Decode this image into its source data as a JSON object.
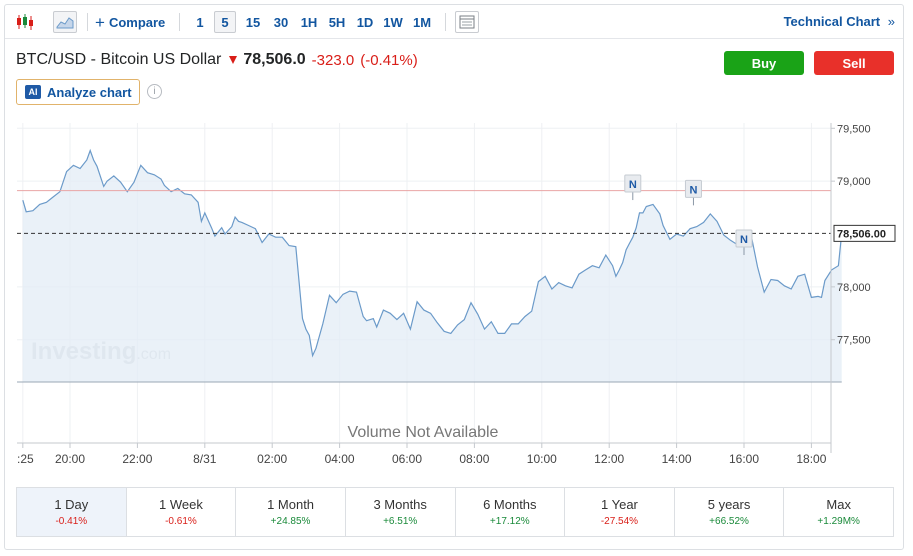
{
  "toolbar": {
    "compare_label": "Compare",
    "intervals": [
      "1",
      "5",
      "15",
      "30",
      "1H",
      "5H",
      "1D",
      "1W",
      "1M"
    ],
    "active_interval": "5",
    "technical_chart_label": "Technical Chart",
    "technical_chart_arrow": "»"
  },
  "instrument": {
    "name": "BTC/USD - Bitcoin US Dollar",
    "price": "78,506.0",
    "change": "-323.0",
    "change_pct": "(-0.41%)"
  },
  "actions": {
    "buy_label": "Buy",
    "sell_label": "Sell",
    "buy_color": "#1aa317",
    "sell_color": "#e8302a"
  },
  "analyze": {
    "ai_badge": "AI",
    "label": "Analyze chart",
    "info_glyph": "i"
  },
  "chart_data": {
    "type": "area",
    "watermark_main": "Investing",
    "watermark_suffix": ".com",
    "volume_text": "Volume Not Available",
    "y_ticks": [
      "79,500",
      "79,000",
      "78,000",
      "77,500"
    ],
    "y_tick_values": [
      79500,
      79000,
      78000,
      77500
    ],
    "ylim": [
      77100,
      79550
    ],
    "current_price_label": "78,506.00",
    "current_price": 78506,
    "prev_close_line": 78910,
    "x_ticks": [
      ":25",
      "20:00",
      "22:00",
      "8/31",
      "02:00",
      "04:00",
      "06:00",
      "08:00",
      "10:00",
      "12:00",
      "14:00",
      "16:00",
      "18:00"
    ],
    "x_tick_positions": [
      -0.4,
      1,
      3,
      5,
      7,
      9,
      11,
      13,
      15,
      17,
      19,
      21,
      23
    ],
    "news_markers": [
      {
        "label": "N",
        "x": 17.7,
        "y": 78840
      },
      {
        "label": "N",
        "x": 19.5,
        "y": 78790
      },
      {
        "label": "N",
        "x": 21,
        "y": 78320
      }
    ],
    "line_color": "#6b9ac9",
    "fill_color": "#e3ecf5",
    "series": [
      {
        "values": [
          [
            -0.4,
            78820
          ],
          [
            -0.3,
            78710
          ],
          [
            -0.1,
            78720
          ],
          [
            0.1,
            78780
          ],
          [
            0.3,
            78800
          ],
          [
            0.5,
            78850
          ],
          [
            0.7,
            78900
          ],
          [
            0.9,
            79090
          ],
          [
            1.1,
            79150
          ],
          [
            1.3,
            79120
          ],
          [
            1.5,
            79200
          ],
          [
            1.6,
            79290
          ],
          [
            1.7,
            79200
          ],
          [
            1.8,
            79140
          ],
          [
            2.0,
            78950
          ],
          [
            2.1,
            79000
          ],
          [
            2.3,
            79050
          ],
          [
            2.5,
            78990
          ],
          [
            2.7,
            78900
          ],
          [
            2.9,
            78990
          ],
          [
            3.0,
            79070
          ],
          [
            3.1,
            79150
          ],
          [
            3.3,
            79080
          ],
          [
            3.5,
            79060
          ],
          [
            3.7,
            79020
          ],
          [
            3.8,
            78960
          ],
          [
            4.0,
            78900
          ],
          [
            4.2,
            78930
          ],
          [
            4.4,
            78880
          ],
          [
            4.6,
            78870
          ],
          [
            4.8,
            78800
          ],
          [
            4.9,
            78620
          ],
          [
            5.0,
            78700
          ],
          [
            5.2,
            78560
          ],
          [
            5.3,
            78480
          ],
          [
            5.5,
            78560
          ],
          [
            5.6,
            78500
          ],
          [
            5.8,
            78570
          ],
          [
            5.9,
            78660
          ],
          [
            6.0,
            78620
          ],
          [
            6.1,
            78610
          ],
          [
            6.3,
            78580
          ],
          [
            6.5,
            78550
          ],
          [
            6.7,
            78420
          ],
          [
            6.9,
            78500
          ],
          [
            7.1,
            78470
          ],
          [
            7.3,
            78470
          ],
          [
            7.5,
            78390
          ],
          [
            7.7,
            78380
          ],
          [
            7.9,
            77700
          ],
          [
            8.0,
            77600
          ],
          [
            8.1,
            77540
          ],
          [
            8.2,
            77350
          ],
          [
            8.3,
            77420
          ],
          [
            8.5,
            77650
          ],
          [
            8.7,
            77920
          ],
          [
            8.9,
            77850
          ],
          [
            9.1,
            77930
          ],
          [
            9.3,
            77960
          ],
          [
            9.5,
            77950
          ],
          [
            9.7,
            77720
          ],
          [
            9.8,
            77680
          ],
          [
            10.0,
            77700
          ],
          [
            10.1,
            77620
          ],
          [
            10.3,
            77780
          ],
          [
            10.5,
            77750
          ],
          [
            10.7,
            77690
          ],
          [
            10.9,
            77750
          ],
          [
            11.1,
            77600
          ],
          [
            11.3,
            77860
          ],
          [
            11.5,
            77780
          ],
          [
            11.7,
            77750
          ],
          [
            11.9,
            77660
          ],
          [
            12.1,
            77580
          ],
          [
            12.3,
            77560
          ],
          [
            12.5,
            77640
          ],
          [
            12.7,
            77690
          ],
          [
            12.9,
            77850
          ],
          [
            13.1,
            77740
          ],
          [
            13.3,
            77600
          ],
          [
            13.5,
            77670
          ],
          [
            13.7,
            77560
          ],
          [
            13.9,
            77560
          ],
          [
            14.1,
            77650
          ],
          [
            14.3,
            77650
          ],
          [
            14.5,
            77720
          ],
          [
            14.7,
            77770
          ],
          [
            14.9,
            78050
          ],
          [
            15.1,
            78100
          ],
          [
            15.3,
            77980
          ],
          [
            15.5,
            78040
          ],
          [
            15.7,
            78010
          ],
          [
            15.9,
            77990
          ],
          [
            16.1,
            78120
          ],
          [
            16.3,
            78160
          ],
          [
            16.5,
            78200
          ],
          [
            16.7,
            78180
          ],
          [
            16.9,
            78300
          ],
          [
            17.1,
            78200
          ],
          [
            17.2,
            78100
          ],
          [
            17.3,
            78160
          ],
          [
            17.4,
            78230
          ],
          [
            17.5,
            78350
          ],
          [
            17.6,
            78410
          ],
          [
            17.7,
            78470
          ],
          [
            17.8,
            78560
          ],
          [
            17.9,
            78700
          ],
          [
            18.0,
            78700
          ],
          [
            18.1,
            78760
          ],
          [
            18.3,
            78780
          ],
          [
            18.5,
            78690
          ],
          [
            18.6,
            78580
          ],
          [
            18.8,
            78450
          ],
          [
            19.0,
            78500
          ],
          [
            19.2,
            78480
          ],
          [
            19.4,
            78550
          ],
          [
            19.6,
            78570
          ],
          [
            19.8,
            78610
          ],
          [
            20.0,
            78690
          ],
          [
            20.2,
            78620
          ],
          [
            20.4,
            78490
          ],
          [
            20.6,
            78440
          ],
          [
            20.8,
            78400
          ],
          [
            21.0,
            78430
          ],
          [
            21.2,
            78510
          ],
          [
            21.4,
            78190
          ],
          [
            21.6,
            77950
          ],
          [
            21.8,
            78070
          ],
          [
            22.0,
            78060
          ],
          [
            22.2,
            78010
          ],
          [
            22.4,
            77980
          ],
          [
            22.6,
            78100
          ],
          [
            22.8,
            78120
          ],
          [
            23.0,
            77900
          ],
          [
            23.2,
            77910
          ],
          [
            23.3,
            77900
          ],
          [
            23.4,
            78060
          ],
          [
            23.6,
            78160
          ],
          [
            23.8,
            78200
          ],
          [
            23.9,
            78506
          ]
        ]
      }
    ]
  },
  "ranges": [
    {
      "label": "1 Day",
      "value": "-0.41%",
      "dir": "neg"
    },
    {
      "label": "1 Week",
      "value": "-0.61%",
      "dir": "neg"
    },
    {
      "label": "1 Month",
      "value": "+24.85%",
      "dir": "pos"
    },
    {
      "label": "3 Months",
      "value": "+6.51%",
      "dir": "pos"
    },
    {
      "label": "6 Months",
      "value": "+17.12%",
      "dir": "pos"
    },
    {
      "label": "1 Year",
      "value": "-27.54%",
      "dir": "neg"
    },
    {
      "label": "5 years",
      "value": "+66.52%",
      "dir": "pos"
    },
    {
      "label": "Max",
      "value": "+1.29M%",
      "dir": "pos"
    }
  ]
}
